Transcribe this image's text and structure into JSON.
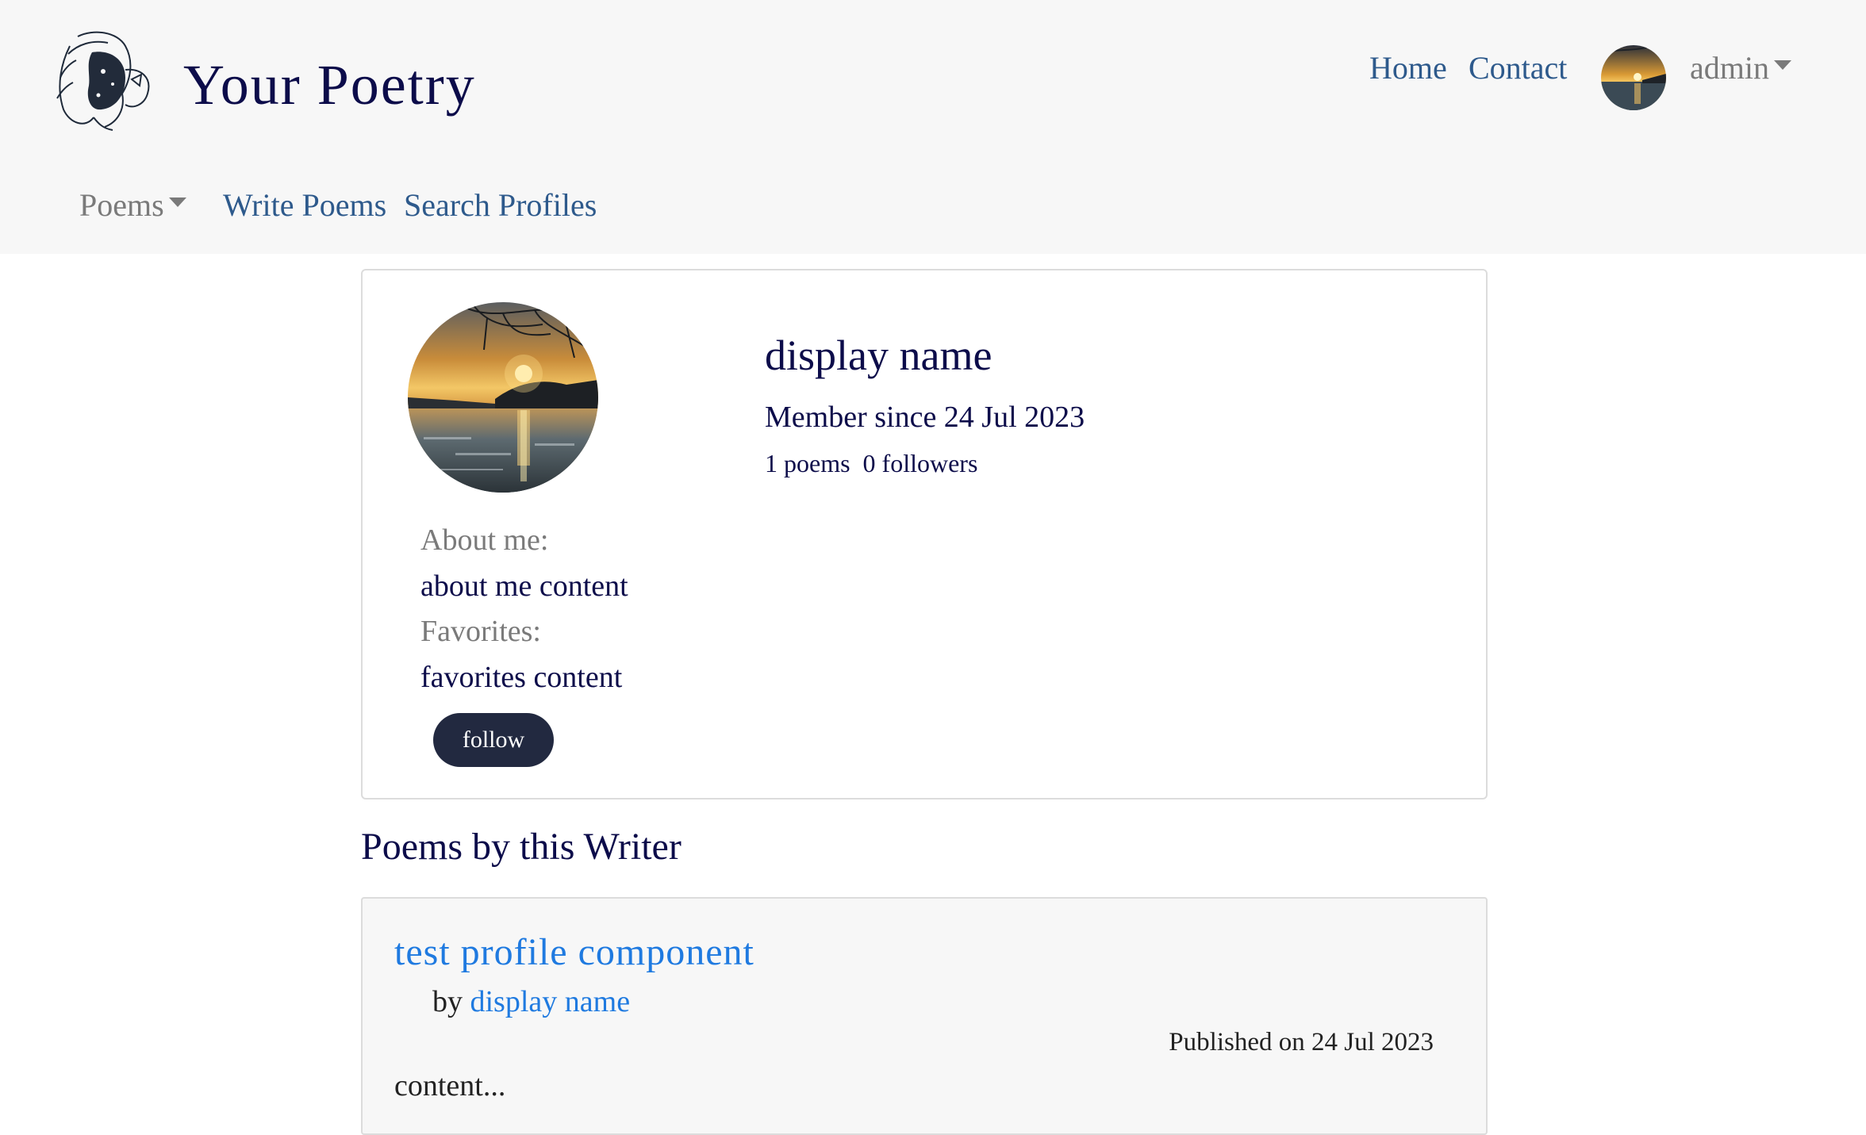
{
  "brand": {
    "title": "Your Poetry"
  },
  "topnav": {
    "home": "Home",
    "contact": "Contact",
    "user": "admin"
  },
  "subnav": {
    "poems": "Poems",
    "write": "Write Poems",
    "search": "Search Profiles"
  },
  "profile": {
    "display_name": "display name",
    "member_since": "Member since 24 Jul 2023",
    "poems_count": "1 poems",
    "followers_count": "0 followers",
    "about_label": "About me:",
    "about_content": "about me content",
    "favorites_label": "Favorites:",
    "favorites_content": "favorites content",
    "follow_label": "follow"
  },
  "poems_section": {
    "title": "Poems by this Writer",
    "items": [
      {
        "title": "test profile component",
        "by": "by",
        "author": "display name",
        "published": "Published on 24 Jul 2023",
        "excerpt": "content..."
      }
    ]
  },
  "colors": {
    "header_bg": "#f7f7f7",
    "nav_link": "#2e5a8c",
    "heading": "#0c0c4a",
    "accent_link": "#1f7ae0",
    "button_bg": "#222940"
  },
  "icons": {
    "logo": "woman-face-line-art-logo",
    "avatar": "sunset-lake-avatar",
    "user_menu": "caret-down-icon"
  }
}
